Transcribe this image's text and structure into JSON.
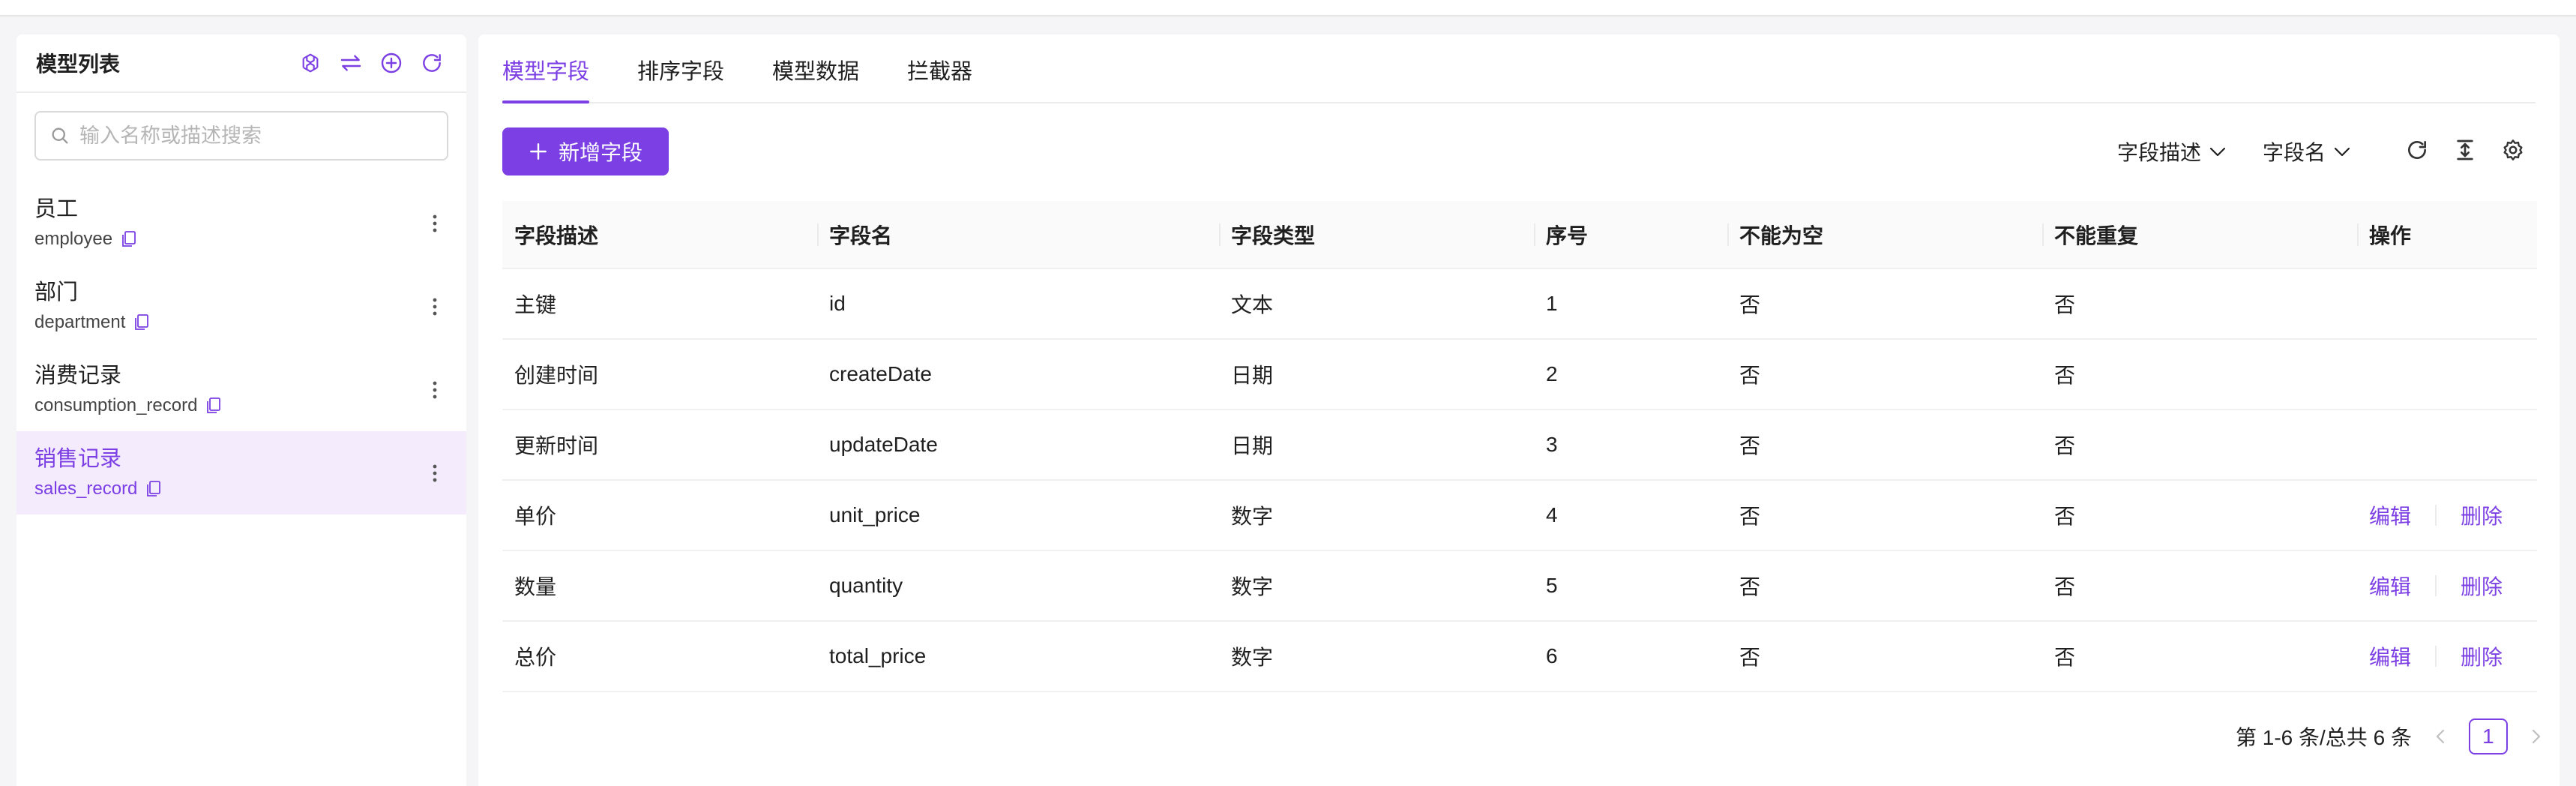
{
  "colors": {
    "accent": "#7b3fe4",
    "active_bg": "#f4ecfd"
  },
  "sidebar": {
    "title": "模型列表",
    "icons": [
      "openai-icon",
      "swap-icon",
      "add-circle-icon",
      "refresh-icon"
    ],
    "search_placeholder": "输入名称或描述搜索",
    "items": [
      {
        "name": "员工",
        "code": "employee",
        "active": false
      },
      {
        "name": "部门",
        "code": "department",
        "active": false
      },
      {
        "name": "消费记录",
        "code": "consumption_record",
        "active": false
      },
      {
        "name": "销售记录",
        "code": "sales_record",
        "active": true
      }
    ]
  },
  "main": {
    "tabs": [
      {
        "label": "模型字段",
        "active": true
      },
      {
        "label": "排序字段",
        "active": false
      },
      {
        "label": "模型数据",
        "active": false
      },
      {
        "label": "拦截器",
        "active": false
      }
    ],
    "add_button_label": "新增字段",
    "filters": [
      "字段描述",
      "字段名"
    ],
    "tool_icons": [
      "refresh-icon",
      "column-height-icon",
      "settings-icon"
    ],
    "table": {
      "columns": [
        "字段描述",
        "字段名",
        "字段类型",
        "序号",
        "不能为空",
        "不能重复",
        "操作"
      ],
      "rows": [
        {
          "desc": "主键",
          "name": "id",
          "type": "文本",
          "seq": "1",
          "not_null": "否",
          "unique": "否",
          "edit": "",
          "delete": ""
        },
        {
          "desc": "创建时间",
          "name": "createDate",
          "type": "日期",
          "seq": "2",
          "not_null": "否",
          "unique": "否",
          "edit": "",
          "delete": ""
        },
        {
          "desc": "更新时间",
          "name": "updateDate",
          "type": "日期",
          "seq": "3",
          "not_null": "否",
          "unique": "否",
          "edit": "",
          "delete": ""
        },
        {
          "desc": "单价",
          "name": "unit_price",
          "type": "数字",
          "seq": "4",
          "not_null": "否",
          "unique": "否",
          "edit": "编辑",
          "delete": "删除"
        },
        {
          "desc": "数量",
          "name": "quantity",
          "type": "数字",
          "seq": "5",
          "not_null": "否",
          "unique": "否",
          "edit": "编辑",
          "delete": "删除"
        },
        {
          "desc": "总价",
          "name": "total_price",
          "type": "数字",
          "seq": "6",
          "not_null": "否",
          "unique": "否",
          "edit": "编辑",
          "delete": "删除"
        }
      ]
    },
    "pagination": {
      "summary": "第 1-6 条/总共 6 条",
      "current": "1"
    }
  }
}
